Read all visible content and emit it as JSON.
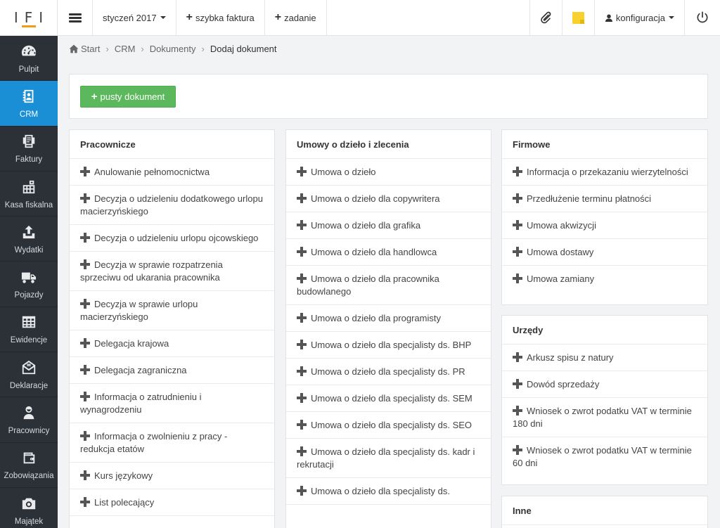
{
  "logo": "IFI",
  "sidebar": {
    "items": [
      {
        "label": "Pulpit",
        "icon": "dashboard-icon"
      },
      {
        "label": "CRM",
        "icon": "address-book-icon",
        "active": true
      },
      {
        "label": "Faktury",
        "icon": "invoice-icon"
      },
      {
        "label": "Kasa fiskalna",
        "icon": "cash-register-icon"
      },
      {
        "label": "Wydatki",
        "icon": "upload-icon"
      },
      {
        "label": "Pojazdy",
        "icon": "truck-icon"
      },
      {
        "label": "Ewidencje",
        "icon": "table-icon"
      },
      {
        "label": "Deklaracje",
        "icon": "envelope-icon"
      },
      {
        "label": "Pracownicy",
        "icon": "user-icon"
      },
      {
        "label": "Zobowiązania",
        "icon": "wallet-icon"
      },
      {
        "label": "Majątek",
        "icon": "camera-icon"
      }
    ]
  },
  "topbar": {
    "period": "styczeń 2017",
    "quick_invoice": "szybka faktura",
    "task": "zadanie",
    "settings": "konfiguracja"
  },
  "breadcrumb": [
    "Start",
    "CRM",
    "Dokumenty",
    "Dodaj dokument"
  ],
  "empty_doc_button": "pusty dokument",
  "columns": [
    {
      "title": "Pracownicze",
      "items": [
        "Anulowanie pełnomocnictwa",
        "Decyzja o udzieleniu dodatkowego urlopu macierzyńskiego",
        "Decyzja o udzieleniu urlopu ojcowskiego",
        "Decyzja w sprawie rozpatrzenia sprzeciwu od ukarania pracownika",
        "Decyzja w sprawie urlopu macierzyńskiego",
        "Delegacja krajowa",
        "Delegacja zagraniczna",
        "Informacja o zatrudnieniu i wynagrodzeniu",
        "Informacja o zwolnieniu z pracy - redukcja etatów",
        "Kurs językowy",
        "List polecający"
      ]
    },
    {
      "title": "Umowy o dzieło i zlecenia",
      "items": [
        "Umowa o dzieło",
        "Umowa o dzieło dla copywritera",
        "Umowa o dzieło dla grafika",
        "Umowa o dzieło dla handlowca",
        "Umowa o dzieło dla pracownika budowlanego",
        "Umowa o dzieło dla programisty",
        "Umowa o dzieło dla specjalisty ds. BHP",
        "Umowa o dzieło dla specjalisty ds. PR",
        "Umowa o dzieło dla specjalisty ds. SEM",
        "Umowa o dzieło dla specjalisty ds. SEO",
        "Umowa o dzieło dla specjalisty ds. kadr i rekrutacji",
        "Umowa o dzieło dla specjalisty ds."
      ]
    },
    {
      "title": "Firmowe",
      "items": [
        "Informacja o przekazaniu wierzytelności",
        "Przedłużenie terminu płatności",
        "Umowa akwizycji",
        "Umowa dostawy",
        "Umowa zamiany"
      ]
    },
    {
      "title": "Urzędy",
      "items": [
        "Arkusz spisu z natury",
        "Dowód sprzedaży",
        "Wniosek o zwrot podatku VAT w terminie 180 dni",
        "Wniosek o zwrot podatku VAT w terminie 60 dni"
      ]
    },
    {
      "title": "Inne",
      "items": []
    }
  ]
}
